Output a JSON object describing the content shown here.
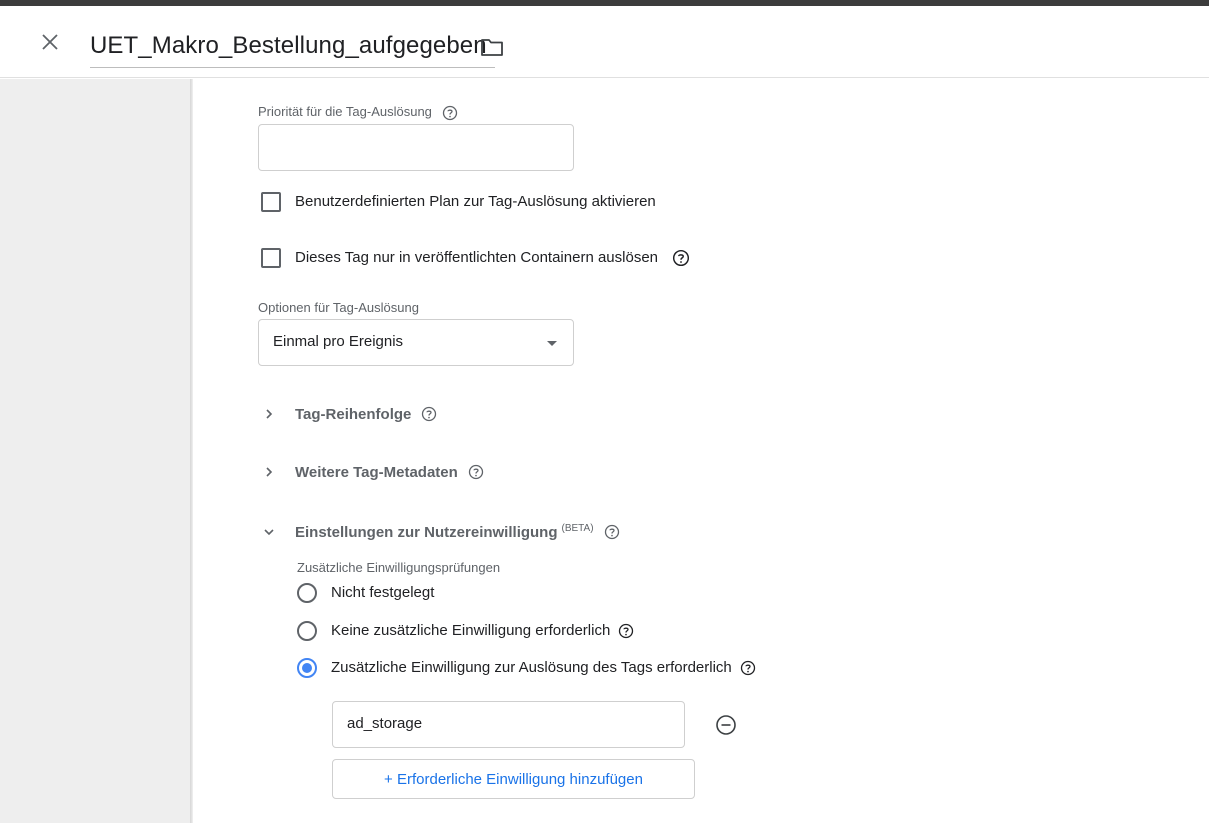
{
  "header": {
    "title": "UET_Makro_Bestellung_aufgegeben",
    "close_icon": "close-icon",
    "folder_icon": "folder-icon"
  },
  "priority": {
    "label": "Priorität für die Tag-Auslösung",
    "value": ""
  },
  "checkboxes": [
    {
      "label": "Benutzerdefinierten Plan zur Tag-Auslösung aktivieren",
      "checked": false
    },
    {
      "label": "Dieses Tag nur in veröffentlichten Containern auslösen",
      "checked": false
    }
  ],
  "firing_options": {
    "label": "Optionen für Tag-Auslösung",
    "selected": "Einmal pro Ereignis"
  },
  "sections": [
    {
      "title": "Tag-Reihenfolge",
      "expanded": false
    },
    {
      "title": "Weitere Tag-Metadaten",
      "expanded": false
    },
    {
      "title": "Einstellungen zur Nutzereinwilligung",
      "badge": "(BETA)",
      "expanded": true
    }
  ],
  "consent": {
    "label": "Zusätzliche Einwilligungsprüfungen",
    "options": [
      {
        "label": "Nicht festgelegt",
        "checked": false
      },
      {
        "label": "Keine zusätzliche Einwilligung erforderlich",
        "checked": false
      },
      {
        "label": "Zusätzliche Einwilligung zur Auslösung des Tags erforderlich",
        "checked": true
      }
    ],
    "required_value": "ad_storage",
    "add_button": "+ Erforderliche Einwilligung hinzufügen"
  },
  "colors": {
    "accent": "#1a73e8",
    "radio_checked": "#4285f4",
    "left_pane": "#eeeeee"
  }
}
